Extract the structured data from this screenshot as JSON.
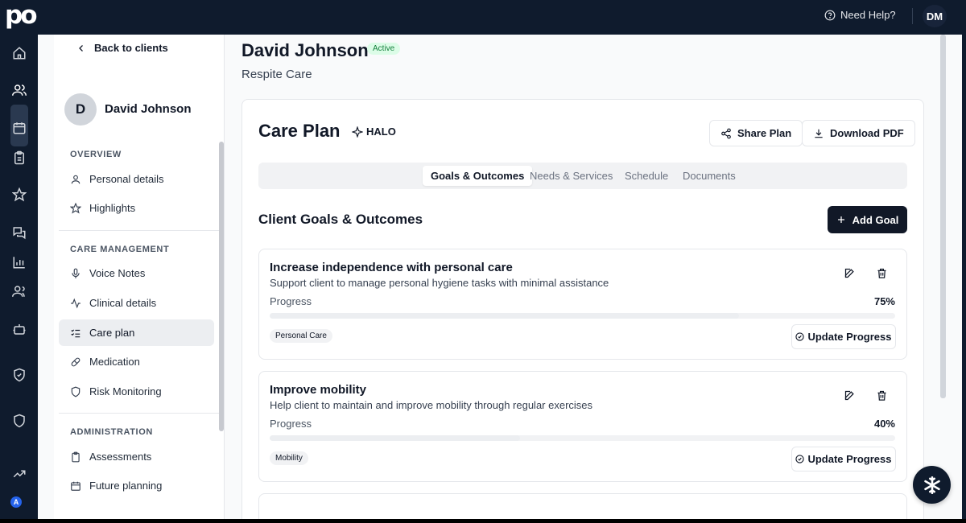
{
  "app": {
    "logo": "po",
    "help_label": "Need Help?",
    "user_initials": "DM",
    "rail_badge": "A"
  },
  "rail": {
    "items": [
      "home-icon",
      "clients-icon",
      "calendar-icon",
      "clipboard-icon",
      "star-icon",
      "messages-icon",
      "chart-icon",
      "team-icon",
      "robot-icon",
      "shield-check-icon",
      "shield-icon",
      "trending-icon"
    ],
    "active": "clients-icon"
  },
  "sidebar": {
    "back_label": "Back to clients",
    "client_initial": "D",
    "client_name": "David Johnson",
    "sections": [
      {
        "title": "OVERVIEW",
        "items": [
          {
            "label": "Personal details",
            "icon": "user-icon"
          },
          {
            "label": "Highlights",
            "icon": "star-icon"
          }
        ]
      },
      {
        "title": "CARE MANAGEMENT",
        "items": [
          {
            "label": "Voice Notes",
            "icon": "mic-icon"
          },
          {
            "label": "Clinical details",
            "icon": "pulse-icon"
          },
          {
            "label": "Care plan",
            "icon": "checklist-icon"
          },
          {
            "label": "Medication",
            "icon": "pill-icon"
          },
          {
            "label": "Risk Monitoring",
            "icon": "shield-icon"
          }
        ]
      },
      {
        "title": "ADMINISTRATION",
        "items": [
          {
            "label": "Assessments",
            "icon": "clipboard-icon"
          },
          {
            "label": "Future planning",
            "icon": "calendar-icon"
          }
        ]
      }
    ],
    "active_item": "Care plan"
  },
  "header": {
    "name": "David Johnson",
    "status": "Active",
    "subtitle": "Respite Care"
  },
  "care_plan": {
    "title": "Care Plan",
    "halo_label": "HALO",
    "share_label": "Share Plan",
    "download_label": "Download PDF",
    "tabs": [
      "Goals & Outcomes",
      "Needs & Services",
      "Schedule",
      "Documents"
    ],
    "active_tab": "Goals & Outcomes",
    "goals_heading": "Client Goals & Outcomes",
    "add_goal_label": "Add Goal",
    "progress_label": "Progress",
    "update_label": "Update Progress",
    "goals": [
      {
        "title": "Increase independence with personal care",
        "description": "Support client to manage personal hygiene tasks with minimal assistance",
        "progress": 75,
        "progress_text": "75%",
        "tag": "Personal Care"
      },
      {
        "title": "Improve mobility",
        "description": "Help client to maintain and improve mobility through regular exercises",
        "progress": 40,
        "progress_text": "40%",
        "tag": "Mobility"
      }
    ]
  },
  "colors": {
    "navy": "#0f1b2d",
    "active_badge_bg": "#dcfce7",
    "active_badge_text": "#15803d",
    "primary_button": "#111827"
  }
}
